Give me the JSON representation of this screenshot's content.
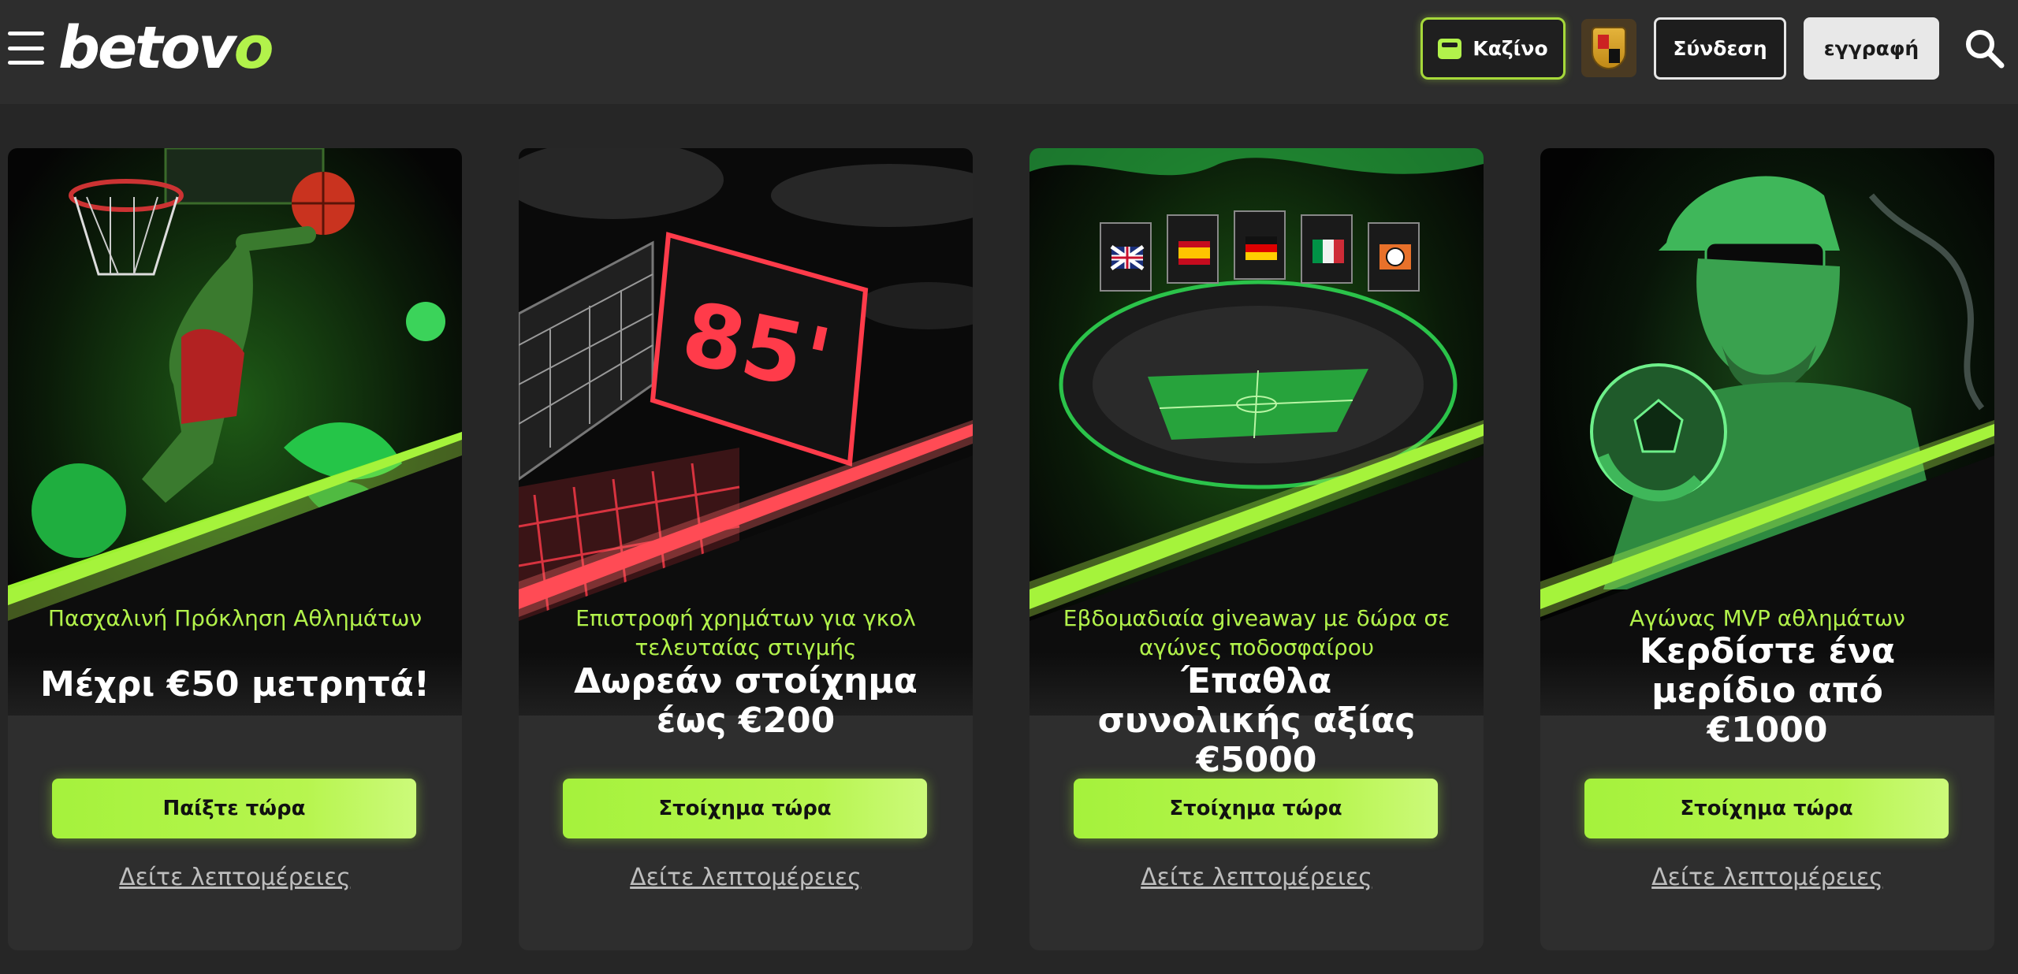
{
  "header": {
    "logo_text": "betovo",
    "casino_label": "Καζίνο",
    "login_label": "Σύνδεση",
    "register_label": "εγγραφή"
  },
  "promos": [
    {
      "subtitle": "Πασχαλινή Πρόκληση Αθλημάτων",
      "title": "Μέχρι €50 μετρητά!",
      "cta": "Παίξτε τώρα",
      "details": "Δείτε λεπτομέρειες",
      "theme": "basketball",
      "glow": "#9cf230"
    },
    {
      "subtitle": "Επιστροφή χρημάτων για γκολ τελευταίας στιγμής",
      "title": "Δωρεάν στοίχημα έως €200",
      "cta": "Στοίχημα τώρα",
      "details": "Δείτε λεπτομέρειες",
      "theme": "scoreboard",
      "scoreboard_text": "85'",
      "glow": "#ff3b4a"
    },
    {
      "subtitle": "Εβδομαδιαία giveaway με δώρα σε αγώνες ποδοσφαίρου",
      "title": "Έπαθλα συνολικής αξίας €5000",
      "cta": "Στοίχημα τώρα",
      "details": "Δείτε λεπτομέρειες",
      "theme": "stadium",
      "glow": "#9cf230"
    },
    {
      "subtitle": "Αγώνας MVP αθλημάτων",
      "title": "Κερδίστε ένα μερίδιο από €1000",
      "cta": "Στοίχημα τώρα",
      "details": "Δείτε λεπτομέρειες",
      "theme": "football-player",
      "glow": "#9cf230"
    }
  ],
  "colors": {
    "accent": "#b2f24b",
    "background": "#262626",
    "card": "#2e2e2e"
  }
}
